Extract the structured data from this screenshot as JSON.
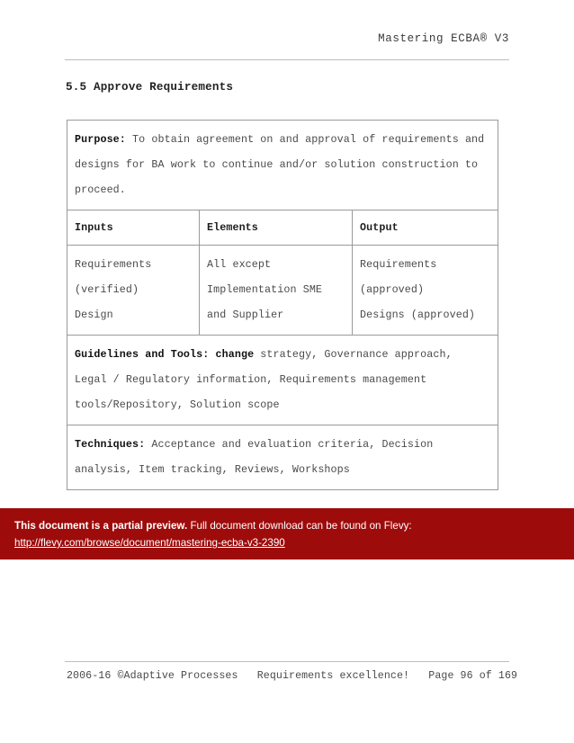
{
  "header": {
    "title": "Mastering ECBA® V3"
  },
  "section": {
    "heading": "5.5 Approve Requirements"
  },
  "table": {
    "purpose": {
      "label": "Purpose:",
      "text": " To obtain agreement on and approval of requirements and designs for BA work to continue and/or solution construction to proceed.",
      "lines": [
        "To obtain agreement on and approval of requirements",
        "and designs for BA work to continue and/or solution construction",
        "to proceed."
      ]
    },
    "columns": [
      "Inputs",
      "Elements",
      "Output"
    ],
    "rows": [
      {
        "inputs": [
          "Requirements",
          "(verified)",
          "Design"
        ],
        "elements": [
          "All except",
          "Implementation SME",
          "and Supplier"
        ],
        "output": [
          "Requirements",
          "(approved)",
          "Designs (approved)"
        ]
      }
    ],
    "guidelines": {
      "label": "Guidelines and Tools: change",
      "text": " strategy, Governance approach, Legal / Regulatory information, Requirements management tools/Repository, Solution scope",
      "lines": [
        "strategy, Governance approach,",
        "Legal / Regulatory information, Requirements management",
        "tools/Repository, Solution scope"
      ]
    },
    "techniques": {
      "label": "Techniques:",
      "text": " Acceptance and evaluation criteria, Decision analysis, Item tracking, Reviews, Workshops",
      "lines": [
        "Acceptance and evaluation criteria, Decision",
        "analysis, Item tracking, Reviews, Workshops"
      ]
    }
  },
  "banner": {
    "strong_text": "This document is a partial preview.",
    "rest_text": " Full document download can be found on Flevy:",
    "url": "http://flevy.com/browse/document/mastering-ecba-v3-2390",
    "background_color": "#9e0b0b",
    "text_color": "#ffffff"
  },
  "footer": {
    "copyright": "2006-16 ©Adaptive Processes",
    "tagline": "Requirements excellence!",
    "page_label": "Page 96 of 169",
    "full_text": "2006-16 ©Adaptive Processes   Requirements excellence!   Page 96 of 169"
  }
}
